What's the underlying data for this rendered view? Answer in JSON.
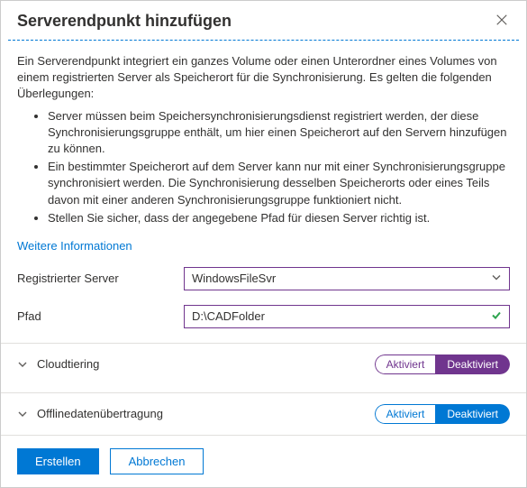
{
  "header": {
    "title": "Serverendpunkt hinzufügen"
  },
  "intro": "Ein Serverendpunkt integriert ein ganzes Volume oder einen Unterordner eines Volumes von einem registrierten Server als Speicherort für die Synchronisierung. Es gelten die folgenden Überlegungen:",
  "considerations": [
    "Server müssen beim Speichersynchronisierungsdienst registriert werden, der diese Synchronisierungsgruppe enthält, um hier einen Speicherort auf den Servern hinzufügen zu können.",
    "Ein bestimmter Speicherort auf dem Server kann nur mit einer Synchronisierungsgruppe synchronisiert werden. Die Synchronisierung desselben Speicherorts oder eines Teils davon mit einer anderen Synchronisierungsgruppe funktioniert nicht.",
    "Stellen Sie sicher, dass der angegebene Pfad für diesen Server richtig ist."
  ],
  "more_info_link": "Weitere Informationen",
  "fields": {
    "registered_server": {
      "label": "Registrierter Server",
      "value": "WindowsFileSvr"
    },
    "path": {
      "label": "Pfad",
      "value": "D:\\CADFolder"
    }
  },
  "sections": {
    "cloud_tiering": {
      "title": "Cloudtiering",
      "option_enabled": "Aktiviert",
      "option_disabled": "Deaktiviert"
    },
    "offline_transfer": {
      "title": "Offlinedatenübertragung",
      "option_enabled": "Aktiviert",
      "option_disabled": "Deaktiviert"
    }
  },
  "footer": {
    "create": "Erstellen",
    "cancel": "Abbrechen"
  }
}
